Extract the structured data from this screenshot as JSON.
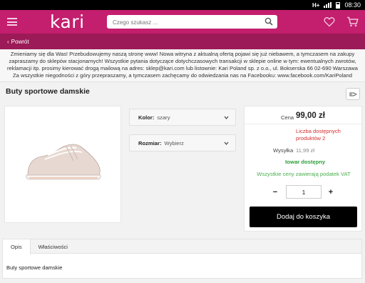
{
  "statusbar": {
    "network": "H+",
    "time": "08:30"
  },
  "header": {
    "logo": "kari",
    "search_placeholder": "Czego szukasz ..."
  },
  "backbar": {
    "label": "Powrót"
  },
  "notice": {
    "text": "Zmieniamy się dla Was! Przebudowujemy naszą stronę www! Nowa witryna z aktualną ofertą pojawi się już niebawem, a tymczasem na zakupy zapraszamy do sklepów stacjonarnych! Wszystkie pytania dotyczące dotychczasowych transakcji w sklepie online w tym: ewentualnych zwrotów, reklamacji itp. prosimy kierować drogą mailową na adres: sklep@kari.com lub listownie: Kari Poland sp. z o.o., ul. Bokserska 66 02-690 Warszawa Za wszystkie niegodności z góry przepraszamy, a tymczasem zachęcamy do odwiedzania nas na Facebooku: www.facebook.com/KariPoland"
  },
  "product": {
    "title": "Buty sportowe damskie",
    "color_label": "Kolor:",
    "color_value": "szary",
    "size_label": "Rozmiar:",
    "size_value": "Wybierz"
  },
  "pricing": {
    "price_label": "Cena",
    "price_value": "99,00 zł",
    "stock_note": "Liczba dostępnych produktów 2",
    "shipping_label": "Wysyłka",
    "shipping_value": "11,99 zł",
    "availability": "towar dostępny",
    "vat_note": "Wszystkie ceny zawierają podatek VAT",
    "quantity": "1",
    "minus": "−",
    "plus": "+",
    "add_to_cart": "Dodaj do koszyka"
  },
  "tabs": {
    "items": [
      "Opis",
      "Właściwości"
    ],
    "active": "Opis",
    "content": "Buty sportowe damskie"
  },
  "colors": {
    "brand": "#c41e6e",
    "brand_dark": "#9b1a57",
    "available": "#2e9e3a",
    "stock_warning": "#d32f2f"
  }
}
